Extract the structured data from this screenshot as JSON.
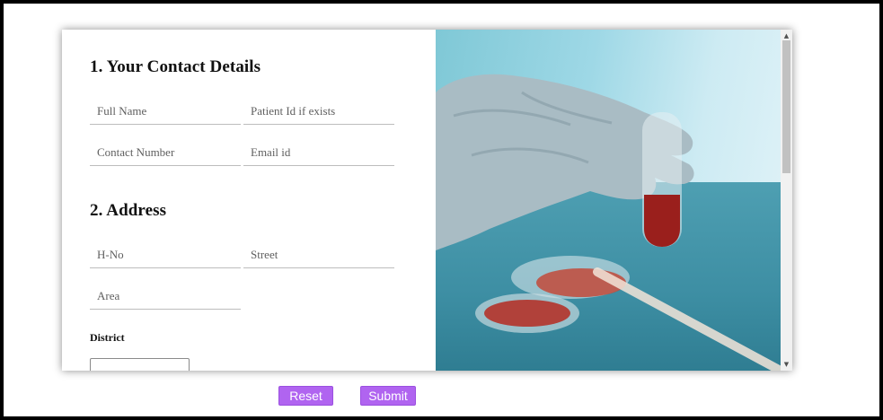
{
  "contact": {
    "heading": "1. Your Contact Details",
    "full_name_placeholder": "Full Name",
    "patient_id_placeholder": "Patient Id if exists",
    "contact_number_placeholder": "Contact Number",
    "email_placeholder": "Email id"
  },
  "address": {
    "heading": "2. Address",
    "hno_placeholder": "H-No",
    "street_placeholder": "Street",
    "area_placeholder": "Area",
    "district_label": "District"
  },
  "photo": {
    "description": "gloved hand holding test tube with red liquid, petri dishes"
  },
  "buttons": {
    "reset_label": "Reset",
    "submit_label": "Submit"
  },
  "colors": {
    "button": "#b064f0",
    "frame_border": "#000000"
  },
  "icons": {
    "scroll_up": "triangle-up",
    "scroll_down": "triangle-down"
  }
}
